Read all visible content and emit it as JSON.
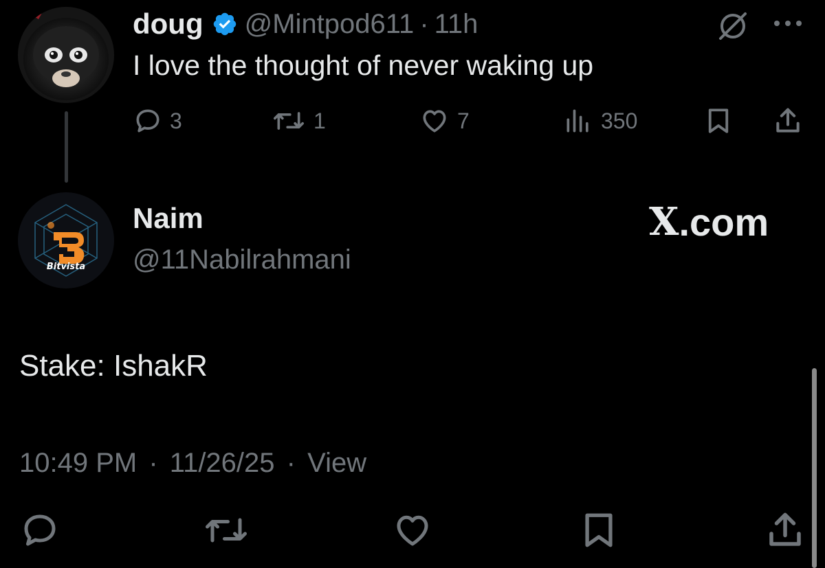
{
  "parent_tweet": {
    "display_name": "doug",
    "handle": "@Mintpod611",
    "separator": "·",
    "time_ago": "11h",
    "text": "I love the thought of never waking up",
    "reply_count": "3",
    "retweet_count": "1",
    "like_count": "7",
    "view_count": "350",
    "icons": {
      "verified": "verified-badge-icon",
      "grok": "grok-icon",
      "more": "more-icon",
      "reply": "reply-icon",
      "retweet": "retweet-icon",
      "like": "heart-icon",
      "views": "views-icon",
      "bookmark": "bookmark-icon",
      "share": "share-icon"
    }
  },
  "reply_tweet": {
    "display_name": "Naim",
    "handle": "@11Nabilrahmani",
    "avatar_label": "Bitvista",
    "watermark_x": "X",
    "watermark_domain": ".com",
    "body": "Stake: IshakR",
    "time": "10:49 PM",
    "date": "11/26/25",
    "sep1": "·",
    "sep2": "·",
    "view_link": "View"
  },
  "colors": {
    "background": "#000000",
    "text_primary": "#e7e9ea",
    "text_secondary": "#71767b",
    "verified_blue": "#1d9bf0",
    "avatar_orange": "#f28c28"
  }
}
